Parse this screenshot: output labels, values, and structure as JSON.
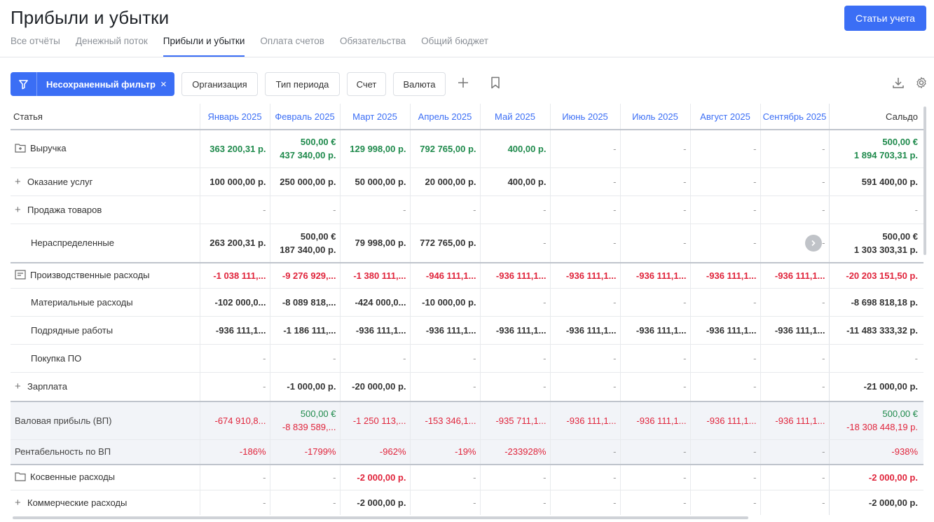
{
  "header": {
    "title": "Прибыли и убытки",
    "accounts_button": "Статьи учета",
    "tabs": [
      "Все отчёты",
      "Денежный поток",
      "Прибыли и убытки",
      "Оплата счетов",
      "Обязательства",
      "Общий бюджет"
    ],
    "active_tab": 2
  },
  "filterbar": {
    "filter_label": "Несохраненный фильтр",
    "close": "×",
    "chips": [
      "Организация",
      "Тип периода",
      "Счет",
      "Валюта"
    ],
    "add": "+"
  },
  "table": {
    "first_col": "Статья",
    "months": [
      "Январь 2025",
      "Февраль 2025",
      "Март 2025",
      "Апрель 2025",
      "Май 2025",
      "Июнь 2025",
      "Июль 2025",
      "Август 2025",
      "Сентябрь 2025"
    ],
    "total_col": "Сальдо",
    "rows": [
      {
        "label": "Выручка",
        "type": "group",
        "icon": "folder-plus-icon",
        "cells": [
          [
            [
              "363 200,31 р.",
              "g"
            ]
          ],
          [
            [
              "500,00 €",
              "g"
            ],
            [
              "437 340,00 р.",
              "g"
            ]
          ],
          [
            [
              "129 998,00 р.",
              "g"
            ]
          ],
          [
            [
              "792 765,00 р.",
              "g"
            ]
          ],
          [
            [
              "400,00 р.",
              "g"
            ]
          ],
          "-",
          "-",
          "-",
          "-"
        ],
        "total": [
          [
            "500,00 €",
            "g"
          ],
          [
            "1 894 703,31 р.",
            "g"
          ]
        ]
      },
      {
        "label": "Оказание услуг",
        "type": "child-plus",
        "cells": [
          "100 000,00 р.",
          "250 000,00 р.",
          "50 000,00 р.",
          "20 000,00 р.",
          "400,00 р.",
          "-",
          "-",
          "-",
          "-"
        ],
        "total": "591 400,00 р."
      },
      {
        "label": "Продажа товаров",
        "type": "child-plus",
        "cells": [
          "-",
          "-",
          "-",
          "-",
          "-",
          "-",
          "-",
          "-",
          "-"
        ],
        "total": "-"
      },
      {
        "label": "Нераспределенные",
        "type": "child",
        "cells": [
          [
            [
              "263 200,31 р.",
              ""
            ]
          ],
          [
            [
              "500,00 €",
              ""
            ],
            [
              "187 340,00 р.",
              ""
            ]
          ],
          [
            [
              "79 998,00 р.",
              ""
            ]
          ],
          [
            [
              "772 765,00 р.",
              ""
            ]
          ],
          "-",
          "-",
          "-",
          "-",
          "-"
        ],
        "total": [
          [
            "500,00 €",
            ""
          ],
          [
            "1 303 303,31 р.",
            ""
          ]
        ]
      },
      {
        "label": "Производственные расходы",
        "type": "group",
        "icon": "document-icon",
        "cells": [
          [
            [
              "-1 038 111,...",
              "r"
            ]
          ],
          [
            [
              "-9 276 929,...",
              "r"
            ]
          ],
          [
            [
              "-1 380 111,...",
              "r"
            ]
          ],
          [
            [
              "-946 111,1...",
              "r"
            ]
          ],
          [
            [
              "-936 111,1...",
              "r"
            ]
          ],
          [
            [
              "-936 111,1...",
              "r"
            ]
          ],
          [
            [
              "-936 111,1...",
              "r"
            ]
          ],
          [
            [
              "-936 111,1...",
              "r"
            ]
          ],
          [
            [
              "-936 111,1...",
              "r"
            ]
          ]
        ],
        "total": [
          [
            "-20 203 151,50 р.",
            "r"
          ]
        ]
      },
      {
        "label": "Материальные расходы",
        "type": "child",
        "cells": [
          "-102 000,0...",
          "-8 089 818,...",
          "-424 000,0...",
          "-10 000,00 р.",
          "-",
          "-",
          "-",
          "-",
          "-"
        ],
        "total": "-8 698 818,18 р."
      },
      {
        "label": "Подрядные работы",
        "type": "child",
        "cells": [
          "-936 111,1...",
          "-1 186 111,...",
          "-936 111,1...",
          "-936 111,1...",
          "-936 111,1...",
          "-936 111,1...",
          "-936 111,1...",
          "-936 111,1...",
          "-936 111,1..."
        ],
        "total": "-11 483 333,32 р."
      },
      {
        "label": "Покупка ПО",
        "type": "child",
        "cells": [
          "-",
          "-",
          "-",
          "-",
          "-",
          "-",
          "-",
          "-",
          "-"
        ],
        "total": "-"
      },
      {
        "label": "Зарплата",
        "type": "child-plus",
        "cells": [
          "-",
          "-1 000,00 р.",
          "-20 000,00 р.",
          "-",
          "-",
          "-",
          "-",
          "-",
          "-"
        ],
        "total": "-21 000,00 р."
      },
      {
        "label": "Валовая прибыль (ВП)",
        "type": "summary",
        "cells": [
          [
            [
              "-674 910,8...",
              "rn"
            ]
          ],
          [
            [
              "500,00 €",
              "gn"
            ],
            [
              "-8 839 589,...",
              "rn"
            ]
          ],
          [
            [
              "-1 250 113,...",
              "rn"
            ]
          ],
          [
            [
              "-153 346,1...",
              "rn"
            ]
          ],
          [
            [
              "-935 711,1...",
              "rn"
            ]
          ],
          [
            [
              "-936 111,1...",
              "rn"
            ]
          ],
          [
            [
              "-936 111,1...",
              "rn"
            ]
          ],
          [
            [
              "-936 111,1...",
              "rn"
            ]
          ],
          [
            [
              "-936 111,1...",
              "rn"
            ]
          ]
        ],
        "total": [
          [
            "500,00 €",
            "gn"
          ],
          [
            "-18 308 448,19 р.",
            "rn"
          ]
        ]
      },
      {
        "label": "Рентабельность по ВП",
        "type": "summary2",
        "cells": [
          [
            [
              "-186%",
              "rn"
            ]
          ],
          [
            [
              "-1799%",
              "rn"
            ]
          ],
          [
            [
              "-962%",
              "rn"
            ]
          ],
          [
            [
              "-19%",
              "rn"
            ]
          ],
          [
            [
              "-233928%",
              "rn"
            ]
          ],
          "-",
          "-",
          "-",
          "-"
        ],
        "total": [
          [
            "-938%",
            "rn"
          ]
        ]
      },
      {
        "label": "Косвенные расходы",
        "type": "group",
        "icon": "folder-icon",
        "cells": [
          "-",
          "-",
          [
            [
              "-2 000,00 р.",
              "r"
            ]
          ],
          "-",
          "-",
          "-",
          "-",
          "-",
          "-"
        ],
        "total": [
          [
            "-2 000,00 р.",
            "r"
          ]
        ]
      },
      {
        "label": "Коммерческие расходы",
        "type": "child-plus",
        "cells": [
          "-",
          "-",
          "-2 000,00 р.",
          "-",
          "-",
          "-",
          "-",
          "-",
          "-"
        ],
        "total": "-2 000,00 р."
      }
    ]
  },
  "colors": {
    "accent": "#3b6ef5",
    "positive": "#1f8a4c",
    "negative": "#e0243b"
  }
}
